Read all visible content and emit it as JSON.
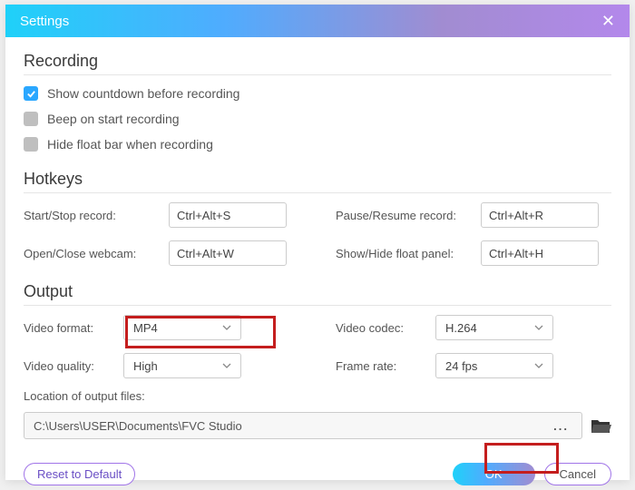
{
  "titlebar": {
    "title": "Settings"
  },
  "recording": {
    "heading": "Recording",
    "countdown_label": "Show countdown before recording",
    "beep_label": "Beep on start recording",
    "hidefloat_label": "Hide float bar when recording"
  },
  "hotkeys": {
    "heading": "Hotkeys",
    "start_stop_label": "Start/Stop record:",
    "start_stop_value": "Ctrl+Alt+S",
    "pause_resume_label": "Pause/Resume record:",
    "pause_resume_value": "Ctrl+Alt+R",
    "open_close_label": "Open/Close webcam:",
    "open_close_value": "Ctrl+Alt+W",
    "show_hide_label": "Show/Hide float panel:",
    "show_hide_value": "Ctrl+Alt+H"
  },
  "output": {
    "heading": "Output",
    "video_format_label": "Video format:",
    "video_format_value": "MP4",
    "video_codec_label": "Video codec:",
    "video_codec_value": "H.264",
    "video_quality_label": "Video quality:",
    "video_quality_value": "High",
    "frame_rate_label": "Frame rate:",
    "frame_rate_value": "24 fps",
    "location_label": "Location of output files:",
    "location_value": "C:\\Users\\USER\\Documents\\FVC Studio"
  },
  "footer": {
    "reset_label": "Reset to Default",
    "ok_label": "OK",
    "cancel_label": "Cancel"
  }
}
